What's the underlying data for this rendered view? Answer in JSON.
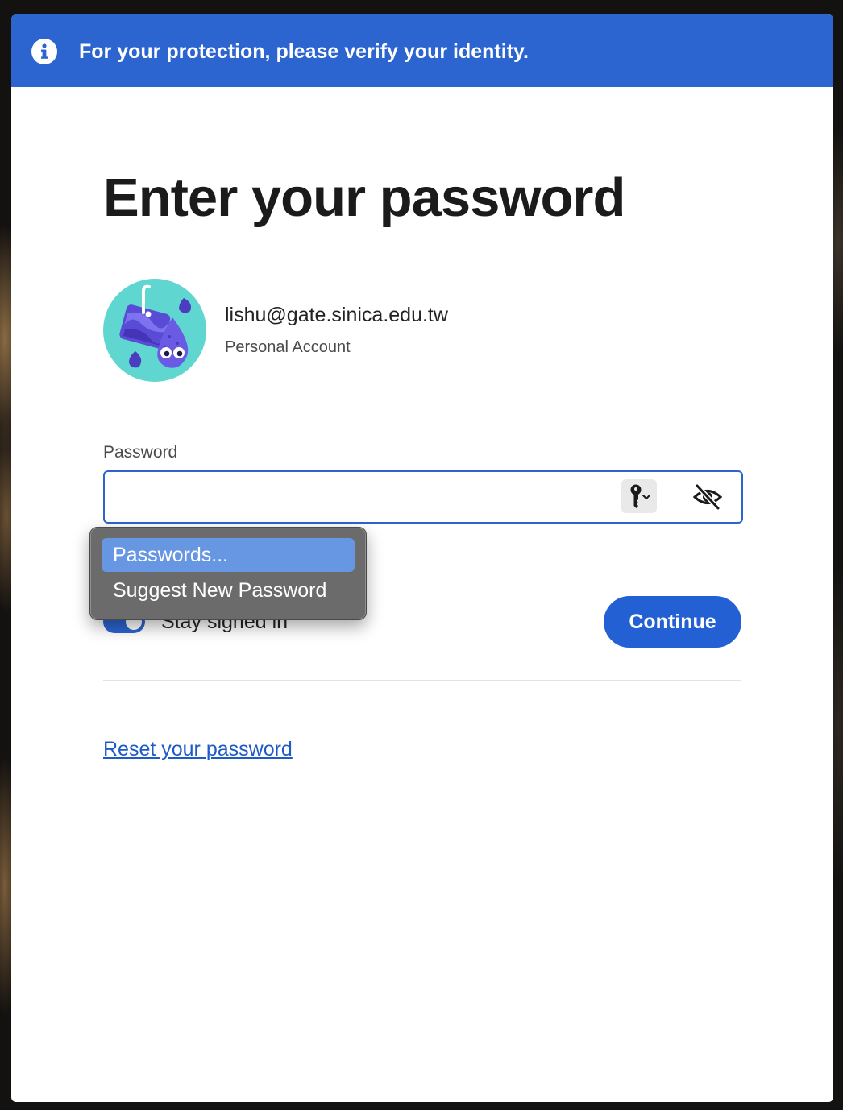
{
  "banner": {
    "icon": "info-icon",
    "message": "For your protection, please verify your identity.",
    "color": "#2c65cf"
  },
  "page": {
    "title": "Enter your password"
  },
  "account": {
    "avatar": "avatar-illustration",
    "email": "lishu@gate.sinica.edu.tw",
    "type": "Personal Account"
  },
  "password": {
    "label": "Password",
    "value": "",
    "key_icon": "key-icon",
    "visibility_icon": "eye-slash-icon"
  },
  "autofill_menu": {
    "items": [
      {
        "label": "Passwords...",
        "selected": true
      },
      {
        "label": "Suggest New Password",
        "selected": false
      }
    ]
  },
  "stay_signed_in": {
    "label": "Stay signed in",
    "enabled": true
  },
  "actions": {
    "continue_label": "Continue",
    "reset_link": "Reset your password"
  },
  "colors": {
    "accent": "#2360d4",
    "link": "#1f5bc7"
  }
}
